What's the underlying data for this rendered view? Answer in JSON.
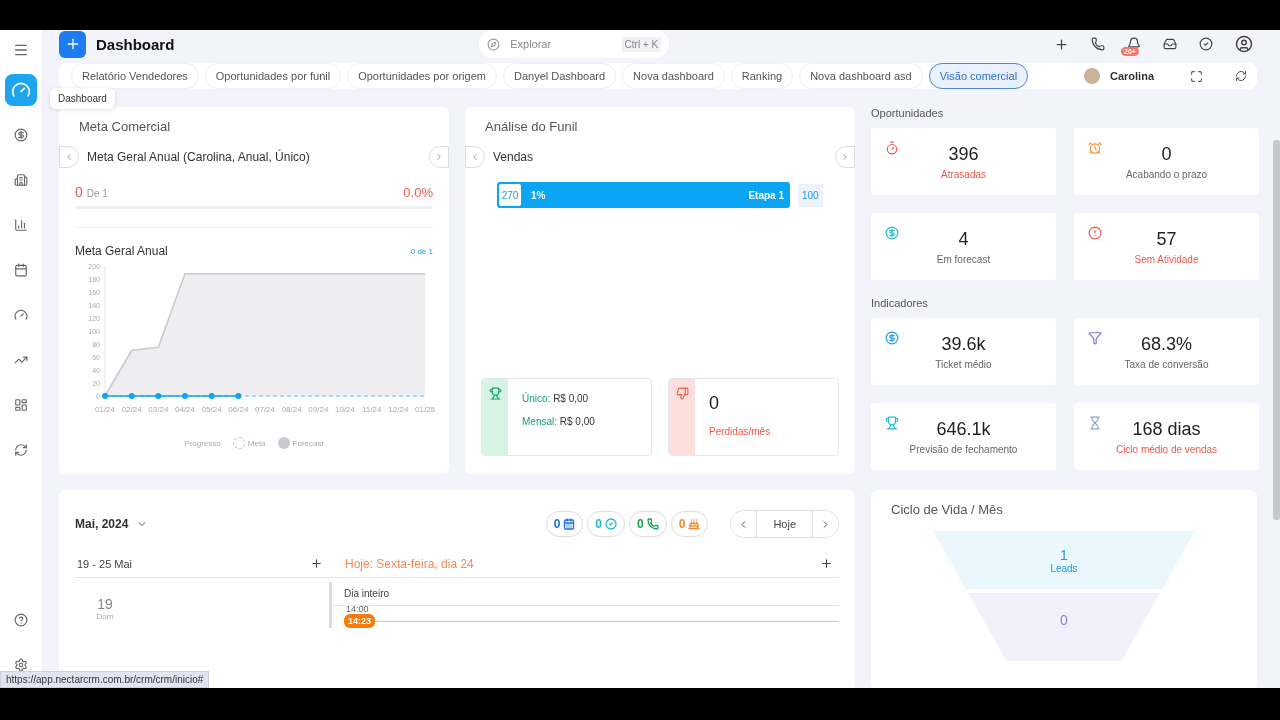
{
  "sidebar": {
    "items": [
      {
        "kind": "dashboard",
        "selected": true
      },
      {
        "kind": "money",
        "selected": false
      },
      {
        "kind": "company",
        "selected": false
      },
      {
        "kind": "report",
        "selected": false
      },
      {
        "kind": "calendar",
        "selected": false
      },
      {
        "kind": "gauge",
        "selected": false
      },
      {
        "kind": "trend",
        "selected": false
      },
      {
        "kind": "layout",
        "selected": false
      },
      {
        "kind": "cycle",
        "selected": false
      }
    ],
    "bottom": [
      {
        "kind": "help"
      },
      {
        "kind": "settings"
      }
    ],
    "tooltip": "Dashboard"
  },
  "header": {
    "title": "Dashboard",
    "search": {
      "placeholder": "Explorar",
      "shortcut": "Ctrl + K"
    },
    "notification_badge": "20+"
  },
  "tabs": [
    {
      "label": "Relatório Vendedores",
      "selected": false
    },
    {
      "label": "Oportunidades por funil",
      "selected": false
    },
    {
      "label": "Oportunidades por origem",
      "selected": false
    },
    {
      "label": "Danyel Dashboard",
      "selected": false
    },
    {
      "label": "Nova dashboard",
      "selected": false
    },
    {
      "label": "Ranking",
      "selected": false
    },
    {
      "label": "Nova dashboard asd",
      "selected": false
    },
    {
      "label": "Visão comercial",
      "selected": true
    }
  ],
  "user": {
    "name": "Carolina"
  },
  "meta_comercial": {
    "title": "Meta Comercial",
    "goal": "Meta Geral Anual (Carolina, Anual, Único)",
    "achieved": "0",
    "of": "De 1",
    "percent": "0.0%",
    "level": 0,
    "chart_title": "Meta Geral Anual",
    "chart_count": "0 de 1",
    "chart_data": {
      "type": "line",
      "categories": [
        "01/24",
        "02/24",
        "03/24",
        "04/24",
        "05/24",
        "06/24",
        "07/24",
        "08/24",
        "09/24",
        "10/24",
        "11/24",
        "12/24",
        "01/25"
      ],
      "ylim": [
        0,
        200
      ],
      "yticks": [
        0,
        20,
        40,
        60,
        80,
        100,
        120,
        140,
        160,
        180,
        200
      ],
      "series": [
        {
          "name": "Progresso",
          "color": "#0ea5e9",
          "marker": true,
          "values": [
            0,
            0,
            0,
            0,
            0,
            0,
            null,
            null,
            null,
            null,
            null,
            null,
            null
          ]
        },
        {
          "name": "Meta",
          "color": "#7dd3fc",
          "line_style": "dashed",
          "values": [
            0,
            0,
            0,
            0,
            0,
            0,
            0,
            0,
            0,
            0,
            0,
            0,
            0
          ]
        },
        {
          "name": "Forecast",
          "color": "#c8c8ce",
          "values": [
            0,
            70,
            75,
            188,
            188,
            188,
            188,
            188,
            188,
            188,
            188,
            188,
            188
          ]
        }
      ]
    }
  },
  "funil": {
    "title": "Análise do Funil",
    "pipeline": "Vendas",
    "stages": [
      {
        "count": "270",
        "percent": "1%",
        "name": "Etapa 1",
        "total": "100"
      }
    ],
    "won": {
      "unique_label": "Único:",
      "unique_value": "R$ 0,00",
      "monthly_label": "Mensal:",
      "monthly_value": "R$ 0,00"
    },
    "lost": {
      "value": "0",
      "label": "Perdidas/mês"
    }
  },
  "oportunidades": {
    "title": "Oportunidades",
    "cards": [
      {
        "value": "396",
        "label": "Atrasadas",
        "alert": true
      },
      {
        "value": "0",
        "label": "Acabando o prazo",
        "alert": false
      },
      {
        "value": "4",
        "label": "Em forecast",
        "alert": false
      },
      {
        "value": "57",
        "label": "Sem Atividade",
        "alert": true
      }
    ]
  },
  "indicadores": {
    "title": "Indicadores",
    "cards": [
      {
        "value": "39.6k",
        "label": "Ticket médio",
        "alert": false
      },
      {
        "value": "68.3%",
        "label": "Taxa de conversão",
        "alert": false
      },
      {
        "value": "646.1k",
        "label": "Previsão de fechamento",
        "alert": false
      },
      {
        "value": "168 dias",
        "label": "Ciclo médio de vendas",
        "alert": true
      }
    ]
  },
  "agenda": {
    "month": "Mai, 2024",
    "counters": [
      {
        "kind": "event",
        "value": "0",
        "color": "#1d6fe0"
      },
      {
        "kind": "task",
        "value": "0",
        "color": "#22b8cf"
      },
      {
        "kind": "call",
        "value": "0",
        "color": "#16a34a"
      },
      {
        "kind": "birthday",
        "value": "0",
        "color": "#f08c2e"
      }
    ],
    "today": "Hoje",
    "week": "19 - 25 Mai",
    "day_title": "Hoje: Sexta-feira, dia 24",
    "day_number": "19",
    "day_name": "Dom",
    "all_day": "Dia inteiro",
    "hour": "14:00",
    "now": "14:23"
  },
  "ciclo_de_vida": {
    "title": "Ciclo de Vida / Mês",
    "stages": [
      {
        "value": "1",
        "label": "Leads"
      },
      {
        "value": "0"
      }
    ]
  },
  "status_url": "https://app.nectarcrm.com.br/crm/crm/inicio#"
}
